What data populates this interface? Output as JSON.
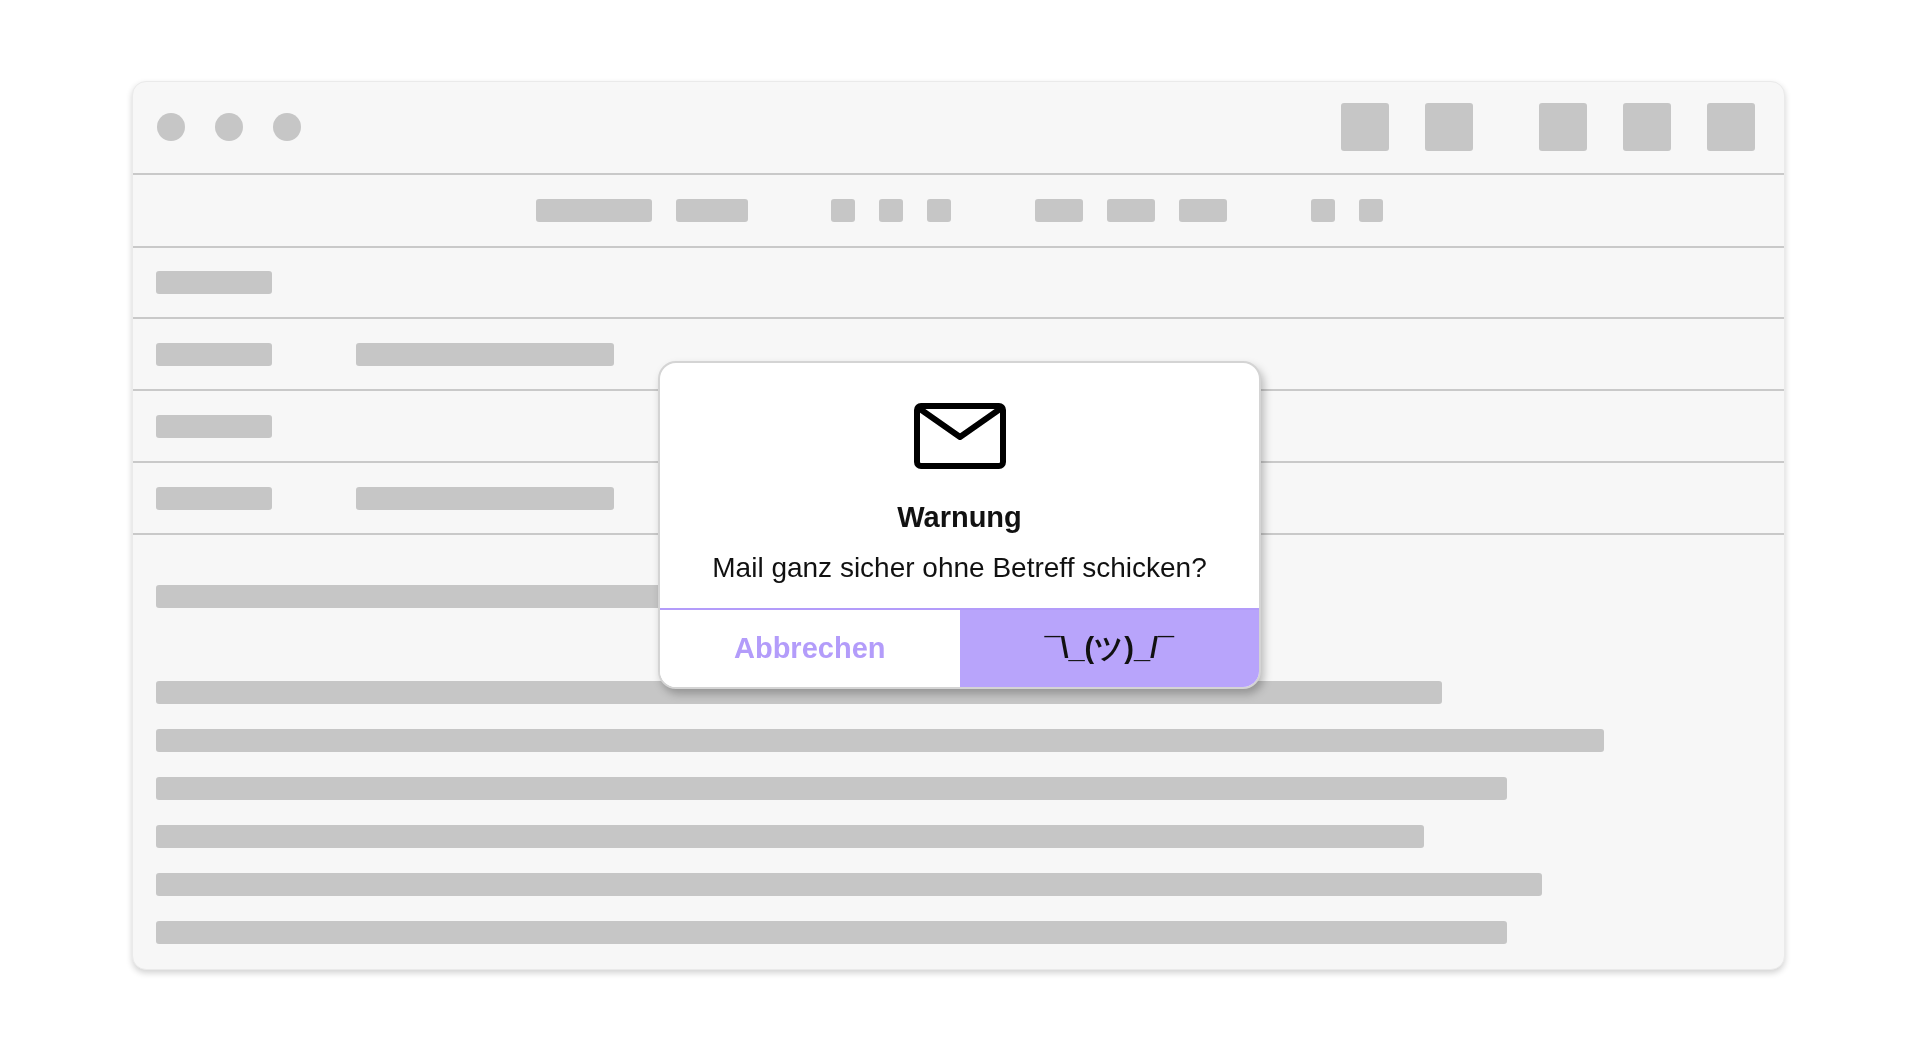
{
  "dialog": {
    "title": "Warnung",
    "message": "Mail ganz sicher ohne Betreff schicken?",
    "buttons": [
      {
        "label": "Abbrechen",
        "primary": false
      },
      {
        "label": "¯\\_(ツ)_/¯",
        "primary": true
      }
    ]
  }
}
